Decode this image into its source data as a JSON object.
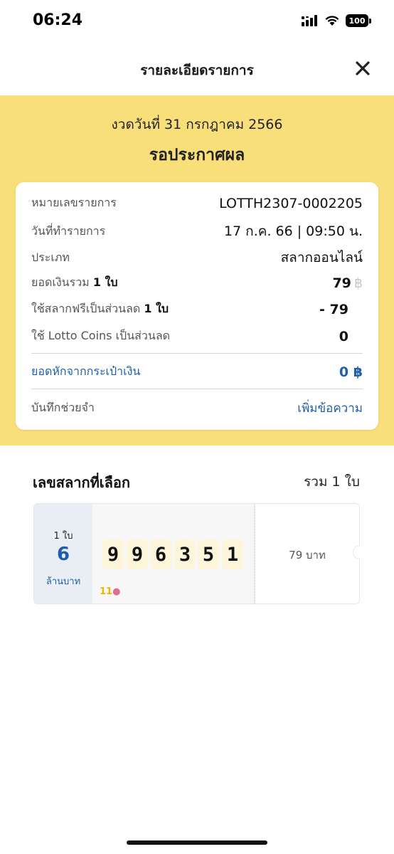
{
  "status_bar": {
    "time": "06:24",
    "battery": "100"
  },
  "header": {
    "title": "รายละเอียดรายการ",
    "close_icon": "close-icon"
  },
  "draw": {
    "date_label": "งวดวันที่ 31 กรกฎาคม 2566",
    "status": "รอประกาศผล"
  },
  "details": {
    "ref_label": "หมายเลขรายการ",
    "ref_value": "LOTTH2307-0002205",
    "date_label": "วันที่ทำรายการ",
    "date_value": "17 ก.ค. 66 | 09:50 น.",
    "type_label": "ประเภท",
    "type_value": "สลากออนไลน์",
    "total_label": "ยอดเงินรวม",
    "total_qty": "1 ใบ",
    "total_value": "79",
    "baht_symbol": "฿",
    "free_label": "ใช้สลากฟรีเป็นส่วนลด",
    "free_qty": "1 ใบ",
    "free_value": "- 79",
    "coins_label": "ใช้ Lotto Coins เป็นส่วนลด",
    "coins_value": "0",
    "wallet_label": "ยอดหักจากกระเป๋าเงิน",
    "wallet_value": "0",
    "note_label": "บันทึกช่วยจำ",
    "note_link": "เพิ่มข้อความ"
  },
  "selected": {
    "title": "เลขสลากที่เลือก",
    "total": "รวม 1 ใบ",
    "ticket": {
      "qty": "1 ใบ",
      "prize_amount": "6",
      "prize_unit": "ล้านบาท",
      "digits": [
        "9",
        "9",
        "6",
        "3",
        "5",
        "1"
      ],
      "price": "79 บาท"
    }
  },
  "colors": {
    "band": "#f8df7a",
    "accent_blue": "#1f5fa8",
    "digit_bg": "#fdf6db"
  }
}
